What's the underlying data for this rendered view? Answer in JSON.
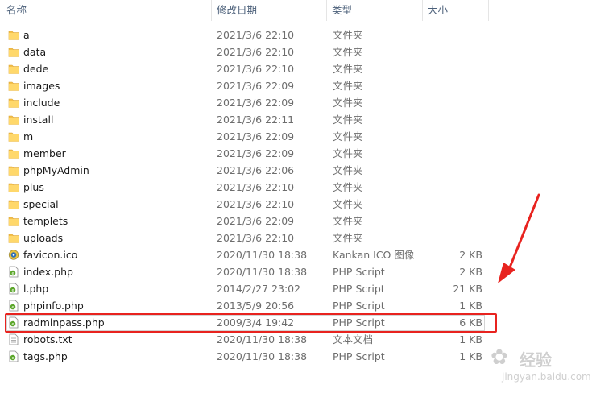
{
  "header": {
    "name_label": "名称",
    "date_label": "修改日期",
    "type_label": "类型",
    "size_label": "大小",
    "sort_indicator": "^"
  },
  "files": [
    {
      "name": "a",
      "date": "2021/3/6 22:10",
      "type": "文件夹",
      "size": "",
      "icon": "folder-icon"
    },
    {
      "name": "data",
      "date": "2021/3/6 22:10",
      "type": "文件夹",
      "size": "",
      "icon": "folder-icon"
    },
    {
      "name": "dede",
      "date": "2021/3/6 22:10",
      "type": "文件夹",
      "size": "",
      "icon": "folder-icon"
    },
    {
      "name": "images",
      "date": "2021/3/6 22:09",
      "type": "文件夹",
      "size": "",
      "icon": "folder-icon"
    },
    {
      "name": "include",
      "date": "2021/3/6 22:09",
      "type": "文件夹",
      "size": "",
      "icon": "folder-icon"
    },
    {
      "name": "install",
      "date": "2021/3/6 22:11",
      "type": "文件夹",
      "size": "",
      "icon": "folder-icon"
    },
    {
      "name": "m",
      "date": "2021/3/6 22:09",
      "type": "文件夹",
      "size": "",
      "icon": "folder-icon"
    },
    {
      "name": "member",
      "date": "2021/3/6 22:09",
      "type": "文件夹",
      "size": "",
      "icon": "folder-icon"
    },
    {
      "name": "phpMyAdmin",
      "date": "2021/3/6 22:06",
      "type": "文件夹",
      "size": "",
      "icon": "folder-icon"
    },
    {
      "name": "plus",
      "date": "2021/3/6 22:10",
      "type": "文件夹",
      "size": "",
      "icon": "folder-icon"
    },
    {
      "name": "special",
      "date": "2021/3/6 22:10",
      "type": "文件夹",
      "size": "",
      "icon": "folder-icon"
    },
    {
      "name": "templets",
      "date": "2021/3/6 22:09",
      "type": "文件夹",
      "size": "",
      "icon": "folder-icon"
    },
    {
      "name": "uploads",
      "date": "2021/3/6 22:10",
      "type": "文件夹",
      "size": "",
      "icon": "folder-icon"
    },
    {
      "name": "favicon.ico",
      "date": "2020/11/30 18:38",
      "type": "Kankan ICO 图像",
      "size": "2 KB",
      "icon": "ico-file-icon"
    },
    {
      "name": "index.php",
      "date": "2020/11/30 18:38",
      "type": "PHP Script",
      "size": "2 KB",
      "icon": "php-file-icon"
    },
    {
      "name": "l.php",
      "date": "2014/2/27 23:02",
      "type": "PHP Script",
      "size": "21 KB",
      "icon": "php-file-icon"
    },
    {
      "name": "phpinfo.php",
      "date": "2013/5/9 20:56",
      "type": "PHP Script",
      "size": "1 KB",
      "icon": "php-file-icon"
    },
    {
      "name": "radminpass.php",
      "date": "2009/3/4 19:42",
      "type": "PHP Script",
      "size": "6 KB",
      "icon": "php-file-icon"
    },
    {
      "name": "robots.txt",
      "date": "2020/11/30 18:38",
      "type": "文本文档",
      "size": "1 KB",
      "icon": "text-file-icon"
    },
    {
      "name": "tags.php",
      "date": "2020/11/30 18:38",
      "type": "PHP Script",
      "size": "1 KB",
      "icon": "php-file-icon"
    }
  ],
  "annotation": {
    "highlight_color": "#e8231f",
    "highlighted_file": "radminpass.php"
  },
  "watermark": {
    "brand": "经验",
    "url": "jingyan.baidu.com"
  },
  "colors": {
    "folder": "#f5c04a",
    "header_text": "#4c607a"
  }
}
